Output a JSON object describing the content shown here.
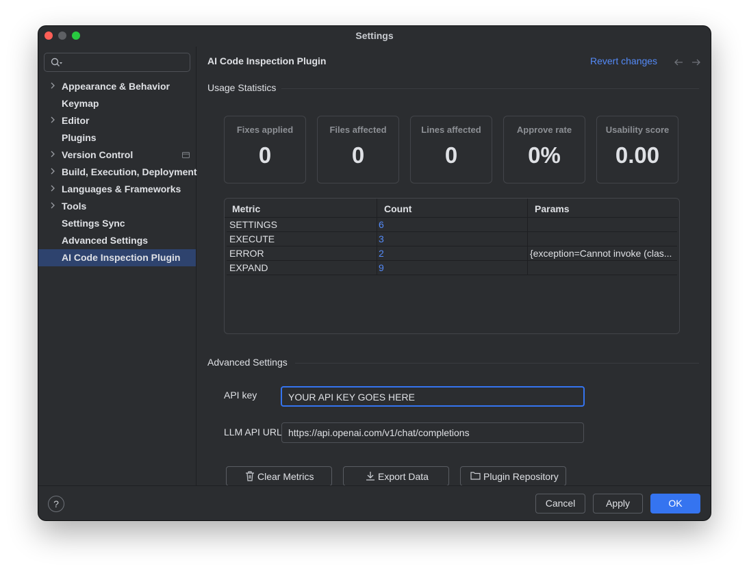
{
  "window": {
    "title": "Settings"
  },
  "search": {
    "placeholder": ""
  },
  "sidebar": {
    "items": [
      {
        "label": "Appearance & Behavior",
        "expandable": true
      },
      {
        "label": "Keymap",
        "expandable": false
      },
      {
        "label": "Editor",
        "expandable": true
      },
      {
        "label": "Plugins",
        "expandable": false
      },
      {
        "label": "Version Control",
        "expandable": true
      },
      {
        "label": "Build, Execution, Deployment",
        "expandable": true
      },
      {
        "label": "Languages & Frameworks",
        "expandable": true
      },
      {
        "label": "Tools",
        "expandable": true
      },
      {
        "label": "Settings Sync",
        "expandable": false
      },
      {
        "label": "Advanced Settings",
        "expandable": false
      },
      {
        "label": "AI Code Inspection Plugin",
        "expandable": false,
        "selected": true
      }
    ]
  },
  "main": {
    "title": "AI Code Inspection Plugin",
    "revert": "Revert changes",
    "usage_section": "Usage Statistics",
    "cards": [
      {
        "label": "Fixes applied",
        "value": "0"
      },
      {
        "label": "Files affected",
        "value": "0"
      },
      {
        "label": "Lines affected",
        "value": "0"
      },
      {
        "label": "Approve rate",
        "value": "0%"
      },
      {
        "label": "Usability score",
        "value": "0.00"
      }
    ],
    "table": {
      "headers": [
        "Metric",
        "Count",
        "Params"
      ],
      "rows": [
        {
          "metric": "SETTINGS",
          "count": "6",
          "params": ""
        },
        {
          "metric": "EXECUTE",
          "count": "3",
          "params": ""
        },
        {
          "metric": "ERROR",
          "count": "2",
          "params": "{exception=Cannot invoke (clas..."
        },
        {
          "metric": "EXPAND",
          "count": "9",
          "params": ""
        }
      ]
    },
    "advanced_section": "Advanced Settings",
    "api_key_label": "API key",
    "api_key_value": "YOUR API KEY GOES HERE",
    "url_label": "LLM API URL",
    "url_value": "https://api.openai.com/v1/chat/completions",
    "buttons": {
      "clear": "Clear Metrics",
      "export": "Export Data",
      "repo": "Plugin Repository"
    }
  },
  "footer": {
    "help": "?",
    "cancel": "Cancel",
    "apply": "Apply",
    "ok": "OK"
  },
  "colors": {
    "accent": "#3574f0",
    "link": "#548af7",
    "background": "#2b2d30",
    "selection": "#2e436e"
  },
  "icons": [
    "search-icon",
    "chevron-right-icon",
    "vcs-folder-icon",
    "arrow-left-icon",
    "arrow-right-icon",
    "trash-icon",
    "download-icon",
    "folder-icon",
    "help-icon"
  ]
}
